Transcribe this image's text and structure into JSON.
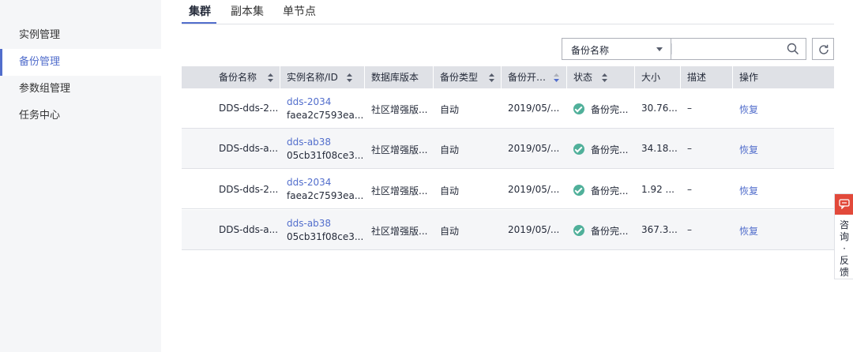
{
  "sidebar": {
    "items": [
      {
        "label": "实例管理"
      },
      {
        "label": "备份管理"
      },
      {
        "label": "参数组管理"
      },
      {
        "label": "任务中心"
      }
    ],
    "active_index": 1
  },
  "tabs": [
    {
      "label": "集群"
    },
    {
      "label": "副本集"
    },
    {
      "label": "单节点"
    }
  ],
  "active_tab": 0,
  "filter": {
    "select_value": "备份名称",
    "search_value": "",
    "search_icon": "search-icon",
    "refresh_icon": "refresh-icon"
  },
  "table": {
    "headers": [
      "备份名称",
      "实例名称/ID",
      "数据库版本",
      "备份类型",
      "备份开…",
      "状态",
      "大小",
      "描述",
      "操作"
    ],
    "rows": [
      {
        "name": "DDS-dds-2...",
        "instance_name": "dds-2034",
        "instance_id": "faea2c7593ea...",
        "version": "社区增强版...",
        "type": "自动",
        "start": "2019/05/...",
        "status": "备份完...",
        "size": "30.76...",
        "desc": "–",
        "action": "恢复"
      },
      {
        "name": "DDS-dds-a...",
        "instance_name": "dds-ab38",
        "instance_id": "05cb31f08ce3...",
        "version": "社区增强版...",
        "type": "自动",
        "start": "2019/05/...",
        "status": "备份完...",
        "size": "34.18...",
        "desc": "–",
        "action": "恢复"
      },
      {
        "name": "DDS-dds-2...",
        "instance_name": "dds-2034",
        "instance_id": "faea2c7593ea...",
        "version": "社区增强版...",
        "type": "自动",
        "start": "2019/05/...",
        "status": "备份完...",
        "size": "1.92 ...",
        "desc": "–",
        "action": "恢复"
      },
      {
        "name": "DDS-dds-a...",
        "instance_name": "dds-ab38",
        "instance_id": "05cb31f08ce3...",
        "version": "社区增强版...",
        "type": "自动",
        "start": "2019/05/...",
        "status": "备份完...",
        "size": "367.3...",
        "desc": "–",
        "action": "恢复"
      }
    ]
  },
  "feedback": {
    "label": "咨询·反馈"
  },
  "colors": {
    "accent": "#526ecc",
    "success": "#50b09a",
    "feedback": "#e2493a"
  }
}
